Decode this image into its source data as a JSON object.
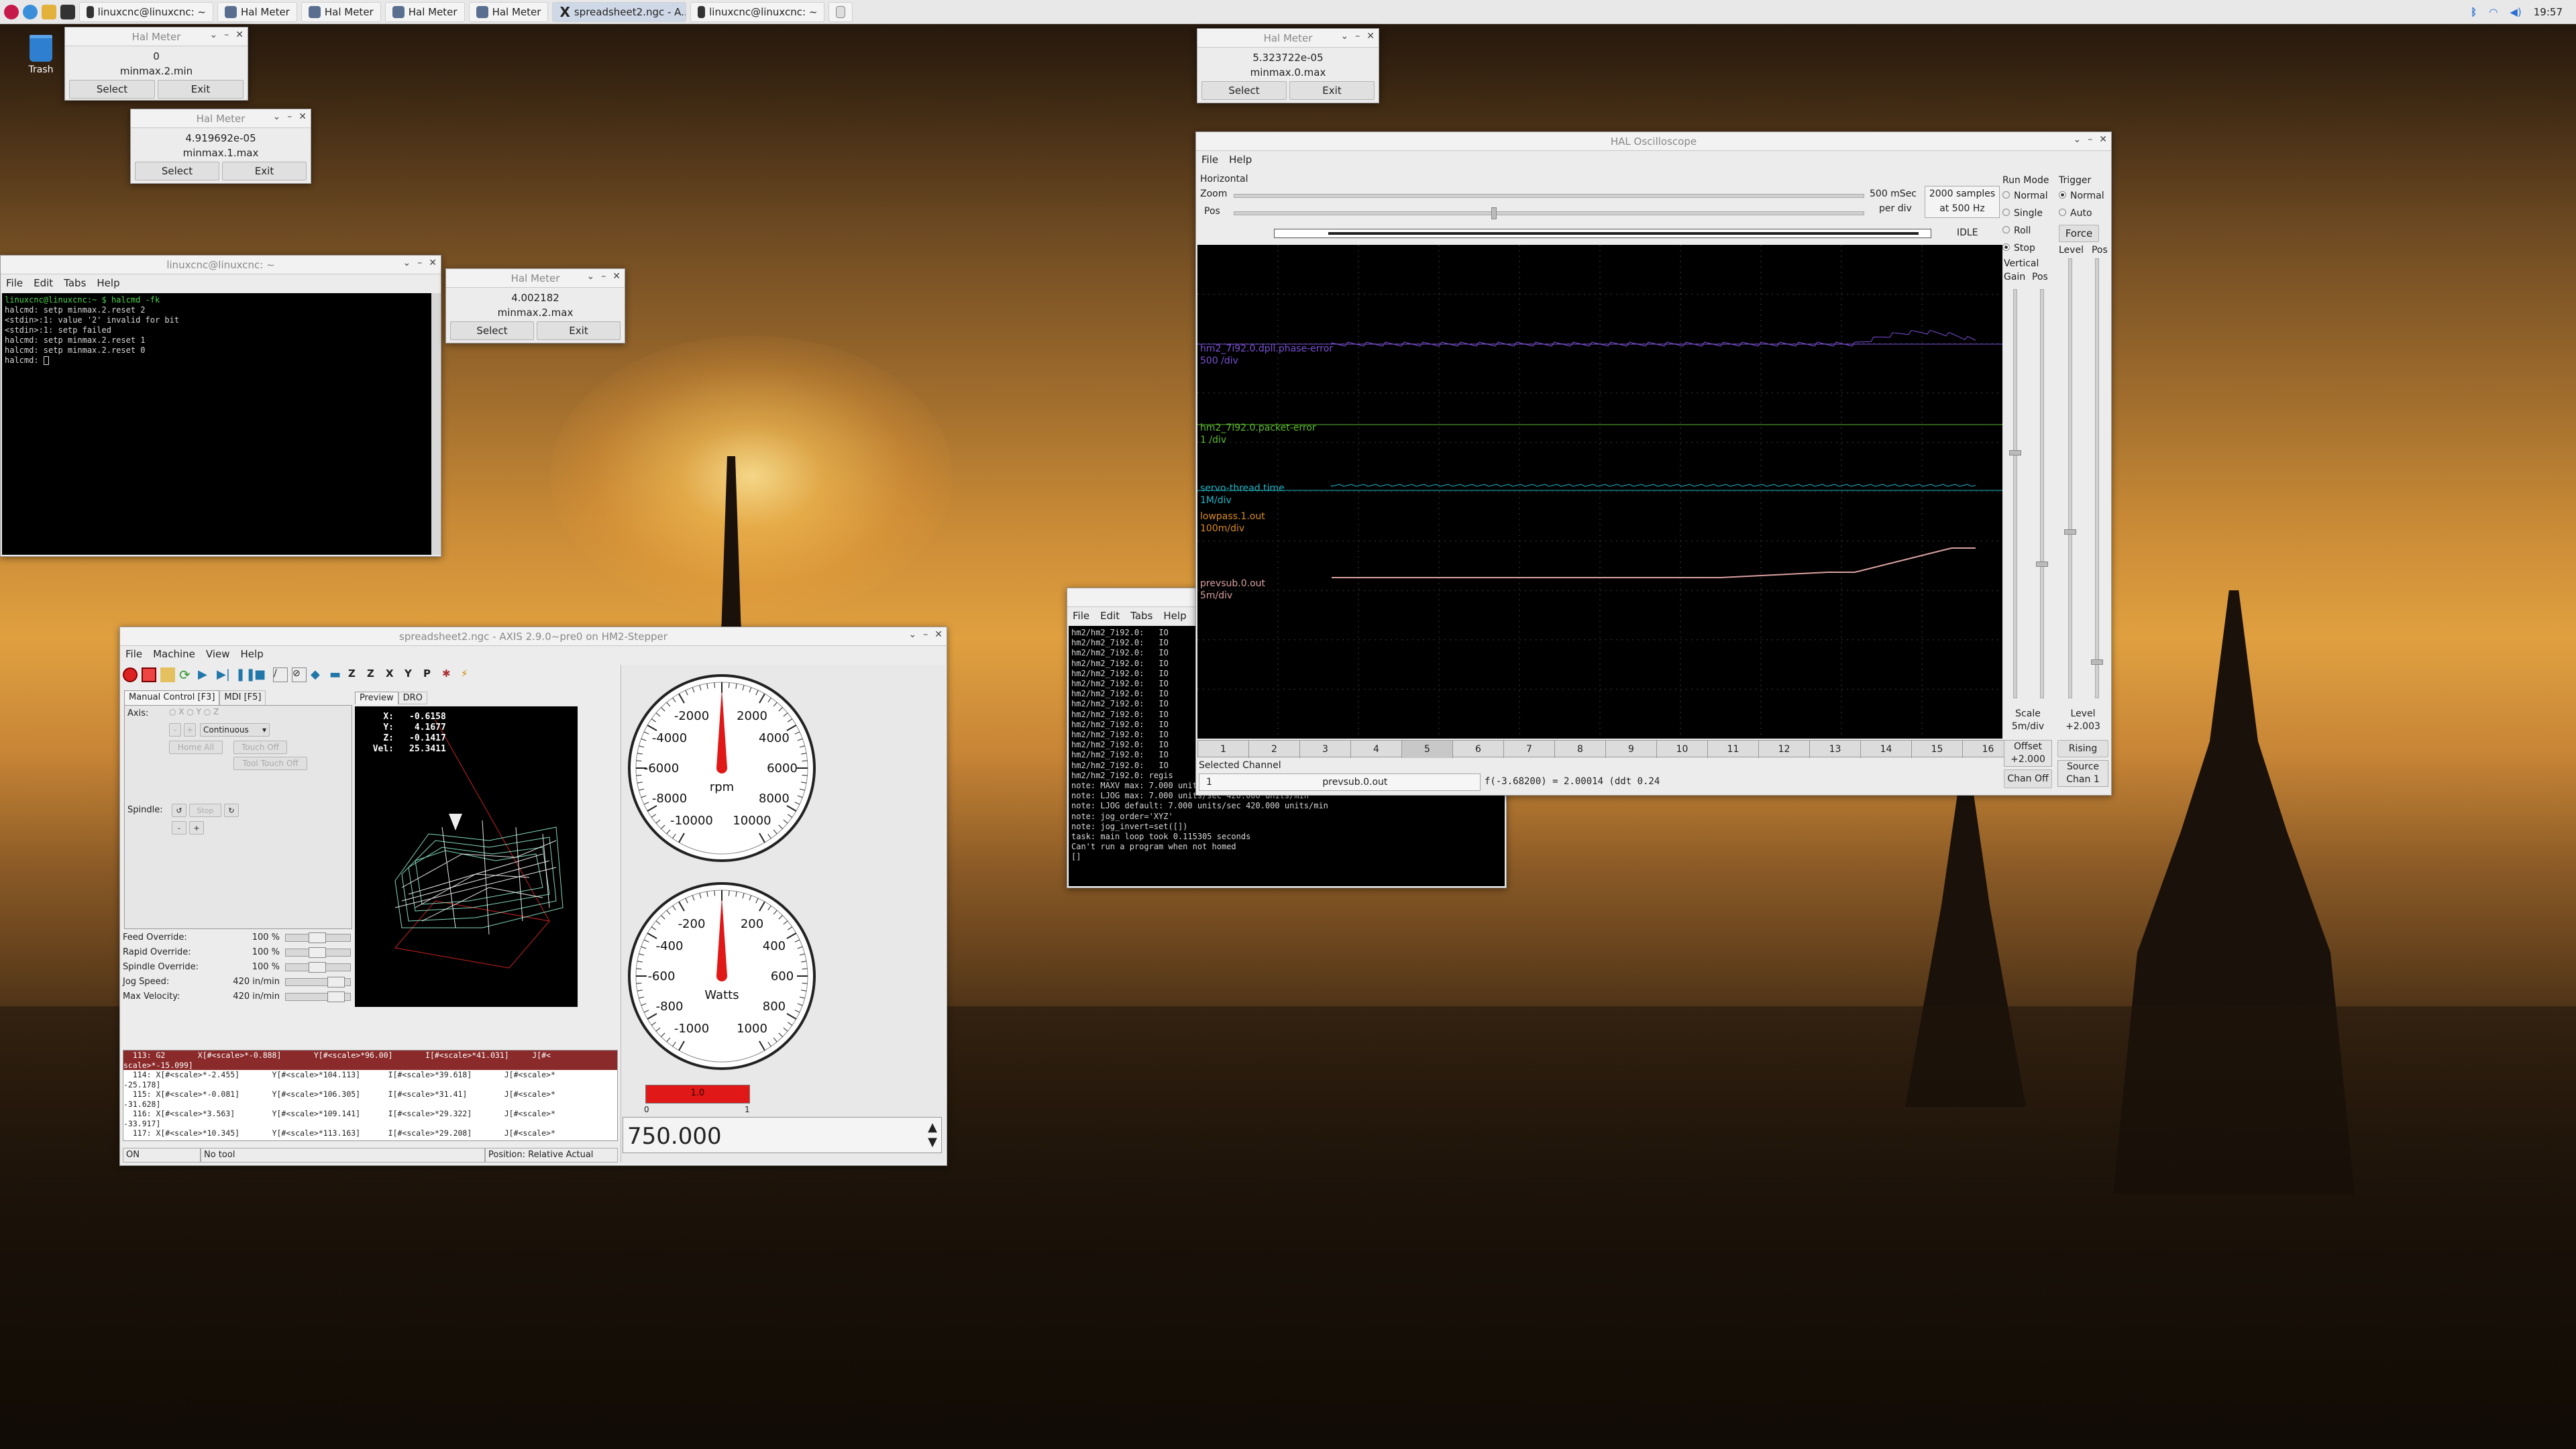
{
  "taskbar": {
    "items": [
      {
        "label": "linuxcnc@linuxcnc: ~",
        "icon": "terminal-icon"
      },
      {
        "label": "Hal Meter",
        "icon": "app-icon"
      },
      {
        "label": "Hal Meter",
        "icon": "app-icon"
      },
      {
        "label": "Hal Meter",
        "icon": "app-icon"
      },
      {
        "label": "Hal Meter",
        "icon": "app-icon"
      },
      {
        "label": "spreadsheet2.ngc - A...",
        "icon": "x-icon"
      },
      {
        "label": "linuxcnc@linuxcnc: ~",
        "icon": "terminal-icon"
      }
    ],
    "clock": "19:57"
  },
  "desktop": {
    "trash_label": "Trash"
  },
  "halmeter1": {
    "title": "Hal Meter",
    "value": "0",
    "pin": "minmax.2.min",
    "select": "Select",
    "exit": "Exit"
  },
  "halmeter2": {
    "title": "Hal Meter",
    "value": "4.919692e-05",
    "pin": "minmax.1.max",
    "select": "Select",
    "exit": "Exit"
  },
  "halmeter3": {
    "title": "Hal Meter",
    "value": "4.002182",
    "pin": "minmax.2.max",
    "select": "Select",
    "exit": "Exit"
  },
  "halmeter4": {
    "title": "Hal Meter",
    "value": "5.323722e-05",
    "pin": "minmax.0.max",
    "select": "Select",
    "exit": "Exit"
  },
  "terminal1": {
    "title": "linuxcnc@linuxcnc: ~",
    "menu": [
      "File",
      "Edit",
      "Tabs",
      "Help"
    ],
    "prompt": "linuxcnc@linuxcnc:~ $ halcmd -fk",
    "lines": [
      "halcmd: setp minmax.2.reset 2",
      "<stdin>:1: value '2' invalid for bit",
      "<stdin>:1: setp failed",
      "halcmd: setp minmax.2.reset 1",
      "halcmd: setp minmax.2.reset 0",
      "halcmd: "
    ]
  },
  "terminal2": {
    "menu": [
      "File",
      "Edit",
      "Tabs",
      "Help"
    ],
    "io_lines": [
      "hm2/hm2_7i92.0:",
      "hm2/hm2_7i92.0:",
      "hm2/hm2_7i92.0:",
      "hm2/hm2_7i92.0:",
      "hm2/hm2_7i92.0:",
      "hm2/hm2_7i92.0:",
      "hm2/hm2_7i92.0:",
      "hm2/hm2_7i92.0:",
      "hm2/hm2_7i92.0:",
      "hm2/hm2_7i92.0:",
      "hm2/hm2_7i92.0:",
      "hm2/hm2_7i92.0:",
      "hm2/hm2_7i92.0:",
      "hm2/hm2_7i92.0:"
    ],
    "io_suffix": "IO",
    "registered": "hm2/hm2_7i92.0: regis",
    "notes": [
      "note: MAXV     max: 7.000 units/sec 420.000 units/min",
      "note: LJOG     max: 7.000 units/sec 420.000 units/min",
      "note: LJOG default: 7.000 units/sec 420.000 units/min",
      "note: jog_order='XYZ'",
      "note: jog_invert=set([])",
      "task: main loop took 0.115305 seconds",
      "Can't run a program when not homed"
    ],
    "cursor": "[]"
  },
  "scope": {
    "title": "HAL Oscilloscope",
    "menu": [
      "File",
      "Help"
    ],
    "horizontal": "Horizontal",
    "zoom": "Zoom",
    "pos": "Pos",
    "msec": "500 mSec",
    "per_div": "per div",
    "samples": "2000 samples",
    "rate": "at 500 Hz",
    "state": "IDLE",
    "run_mode": "Run Mode",
    "run_options": [
      "Normal",
      "Single",
      "Roll",
      "Stop"
    ],
    "trigger": "Trigger",
    "trigger_options": [
      "Normal",
      "Auto"
    ],
    "force": "Force",
    "vertical": "Vertical",
    "gain": "Gain",
    "vpos": "Pos",
    "level_hdr": "Level",
    "pos_hdr": "Pos",
    "scale_label": "Scale",
    "scale_value": "5m/div",
    "offset_label": "Offset",
    "offset_value": "+2.000",
    "chan_off": "Chan Off",
    "level_label": "Level",
    "level_value": "+2.003",
    "rising": "Rising",
    "source_label": "Source",
    "source_value": "Chan 1",
    "channels": [
      "1",
      "2",
      "3",
      "4",
      "5",
      "6",
      "7",
      "8",
      "9",
      "10",
      "11",
      "12",
      "13",
      "14",
      "15",
      "16"
    ],
    "selected_channel": "Selected Channel",
    "selected_num": "1",
    "selected_name": "prevsub.0.out",
    "readout": "f(-3.68200) =  2.00014 (ddt  0.24",
    "traces": [
      {
        "name": "hm2_7i92.0.dpll.phase-error",
        "scale": "500 /div",
        "color": "#7a4fd6"
      },
      {
        "name": "hm2_7i92.0.packet-error",
        "scale": "1 /div",
        "color": "#5dbb2f"
      },
      {
        "name": "servo-thread.time",
        "scale": "1M/div",
        "color": "#1fb6c6"
      },
      {
        "name": "lowpass.1.out",
        "scale": "100m/div",
        "color": "#d98c1f"
      },
      {
        "name": "prevsub.0.out",
        "scale": "5m/div",
        "color": "#d9a0a0"
      }
    ]
  },
  "axis": {
    "title": "spreadsheet2.ngc - AXIS 2.9.0~pre0 on HM2-Stepper",
    "menu": [
      "File",
      "Machine",
      "View",
      "Help"
    ],
    "tabs": [
      "Manual Control [F3]",
      "MDI [F5]"
    ],
    "preview_tabs": [
      "Preview",
      "DRO"
    ],
    "axis_label": "Axis:",
    "mode": "Continuous",
    "home_all": "Home All",
    "touch_off": "Touch Off",
    "tool_touch_off": "Tool Touch Off",
    "spindle": "Spindle:",
    "overrides": [
      {
        "label": "Feed Override:",
        "value": "100 %"
      },
      {
        "label": "Rapid Override:",
        "value": "100 %"
      },
      {
        "label": "Spindle Override:",
        "value": "100 %"
      },
      {
        "label": "Jog Speed:",
        "value": "420 in/min"
      },
      {
        "label": "Max Velocity:",
        "value": "420 in/min"
      }
    ],
    "dro": [
      {
        "axis": "X:",
        "value": "-0.6158"
      },
      {
        "axis": "Y:",
        "value": "4.1677"
      },
      {
        "axis": "Z:",
        "value": "-0.1417"
      },
      {
        "axis": "Vel:",
        "value": "25.3411"
      }
    ],
    "gcode": [
      "  113: G2       X[#<scale>*-0.888]       Y[#<scale>*96.00]       I[#<scale>*41.031]     J[#<",
      "scale>*-15.099]",
      "  114: X[#<scale>*-2.455]       Y[#<scale>*104.113]      I[#<scale>*39.618]       J[#<scale>*",
      "-25.178]",
      "  115: X[#<scale>*-0.081]       Y[#<scale>*106.305]      I[#<scale>*31.41]        J[#<scale>*",
      "-31.628]",
      "  116: X[#<scale>*3.563]        Y[#<scale>*109.141]      I[#<scale>*29.322]       J[#<scale>*",
      "-33.917]",
      "  117: X[#<scale>*10.345]       Y[#<scale>*113.163]      I[#<scale>*29.208]       J[#<scale>*"
    ],
    "status": {
      "state": "ON",
      "tool": "No tool",
      "position": "Position: Relative Actual"
    },
    "gauge1": {
      "unit": "rpm",
      "labels": [
        "-2000",
        "2000",
        "-4000",
        "4000",
        "-6000",
        "6000",
        "-8000",
        "8000",
        "-10000",
        "10000"
      ]
    },
    "gauge2": {
      "unit": "Watts",
      "labels": [
        "-200",
        "200",
        "-400",
        "400",
        "-600",
        "600",
        "-800",
        "800",
        "-1000",
        "1000"
      ]
    },
    "bar": {
      "value": "1.0",
      "min": "0",
      "max": "1",
      "fraction": 1.0
    },
    "spin_value": "750.000"
  }
}
